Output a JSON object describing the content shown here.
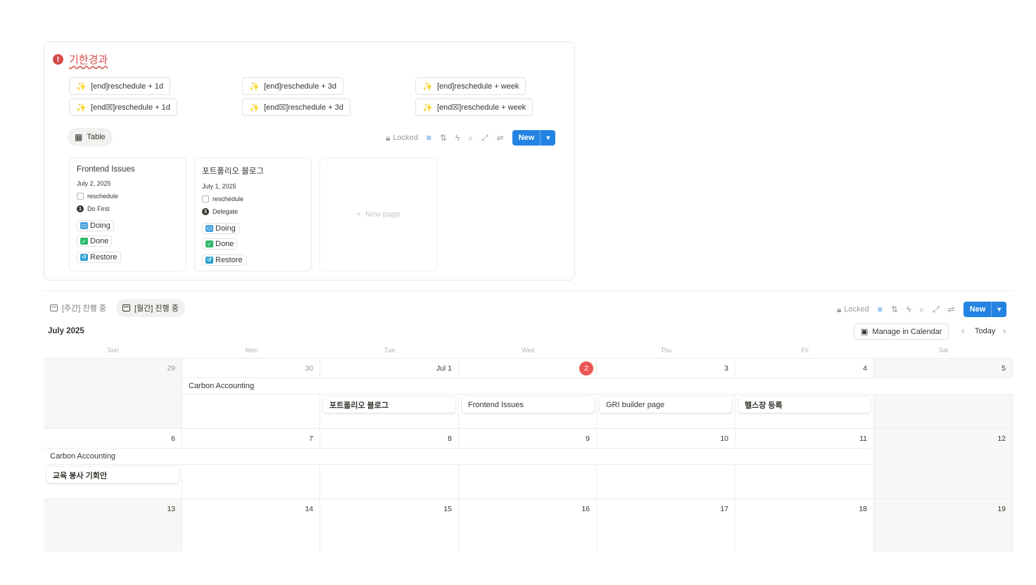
{
  "top_panel": {
    "title": "기한경과",
    "action_buttons": [
      {
        "label": "[end]reschedule + 1d"
      },
      {
        "label": "[end]reschedule + 3d"
      },
      {
        "label": "[end]reschedule + week"
      },
      {
        "label": "[end☒]reschedule + 1d"
      },
      {
        "label": "[end☒]reschedule + 3d"
      },
      {
        "label": "[end☒]reschedule + week"
      }
    ],
    "view_tab": "Table",
    "toolbar": {
      "locked": "Locked",
      "new": "New"
    },
    "cards": [
      {
        "title": "Frontend Issues",
        "date": "July 2, 2025",
        "checkbox_label": "reschedule",
        "priority_num": "1",
        "priority": "Do First",
        "tags": [
          "Doing",
          "Done",
          "Restore"
        ]
      },
      {
        "title": "포트폴리오 블로그",
        "date": "July 1, 2025",
        "checkbox_label": "reschedule",
        "priority_num": "3",
        "priority": "Delegate",
        "tags": [
          "Doing",
          "Done",
          "Restore"
        ]
      }
    ],
    "new_page": "New page"
  },
  "calendar": {
    "tabs": [
      "[주간] 진행 중",
      "[월간] 진행 중"
    ],
    "toolbar": {
      "locked": "Locked",
      "new": "New"
    },
    "month": "July 2025",
    "manage": "Manage in Calendar",
    "today": "Today",
    "weekdays": [
      "Sun",
      "Mon",
      "Tue",
      "Wed",
      "Thu",
      "Fri",
      "Sat"
    ],
    "weeks": [
      [
        "29",
        "30",
        "Jul 1",
        "2",
        "3",
        "4",
        "5"
      ],
      [
        "6",
        "7",
        "8",
        "9",
        "10",
        "11",
        "12"
      ],
      [
        "13",
        "14",
        "15",
        "16",
        "17",
        "18",
        "19"
      ]
    ],
    "events": {
      "week1_span": "Carbon Accounting",
      "week1_tue": "포트폴리오 블로그",
      "week1_wed": "Frontend Issues",
      "week1_thu": "GRI builder page",
      "week1_fri": "헬스장 등록",
      "week2_span": "Carbon Accounting",
      "week2_sun": "교육 봉사 기회안"
    }
  }
}
